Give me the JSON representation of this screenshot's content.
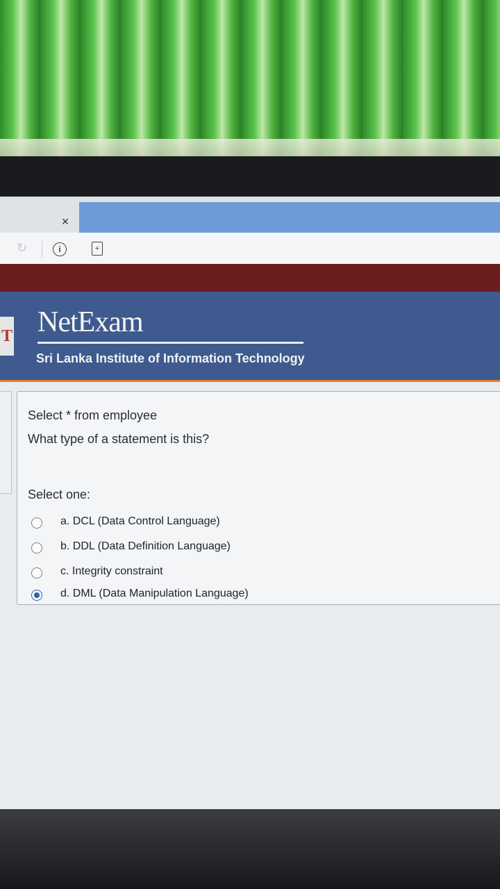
{
  "tab": {
    "close_symbol": "×"
  },
  "address_bar": {
    "info_symbol": "i",
    "page_symbol": "+"
  },
  "site": {
    "brand": "NetExam",
    "organization": "Sri Lanka Institute of Information Technology",
    "logo_letter": "T"
  },
  "question": {
    "line1": "Select * from employee",
    "line2": "What type of a statement is this?",
    "prompt": "Select one:",
    "options": [
      {
        "label": "a. DCL (Data Control Language)",
        "selected": false
      },
      {
        "label": "b. DDL (Data Definition Language)",
        "selected": false
      },
      {
        "label": "c. Integrity constraint",
        "selected": false
      },
      {
        "label": "d. DML (Data Manipulation Language)",
        "selected": true
      }
    ]
  },
  "colors": {
    "header": "#3e5a8e",
    "top_bar": "#6a1c1f",
    "accent_line": "#e07f2c",
    "radio_selected": "#2d5fb0"
  }
}
